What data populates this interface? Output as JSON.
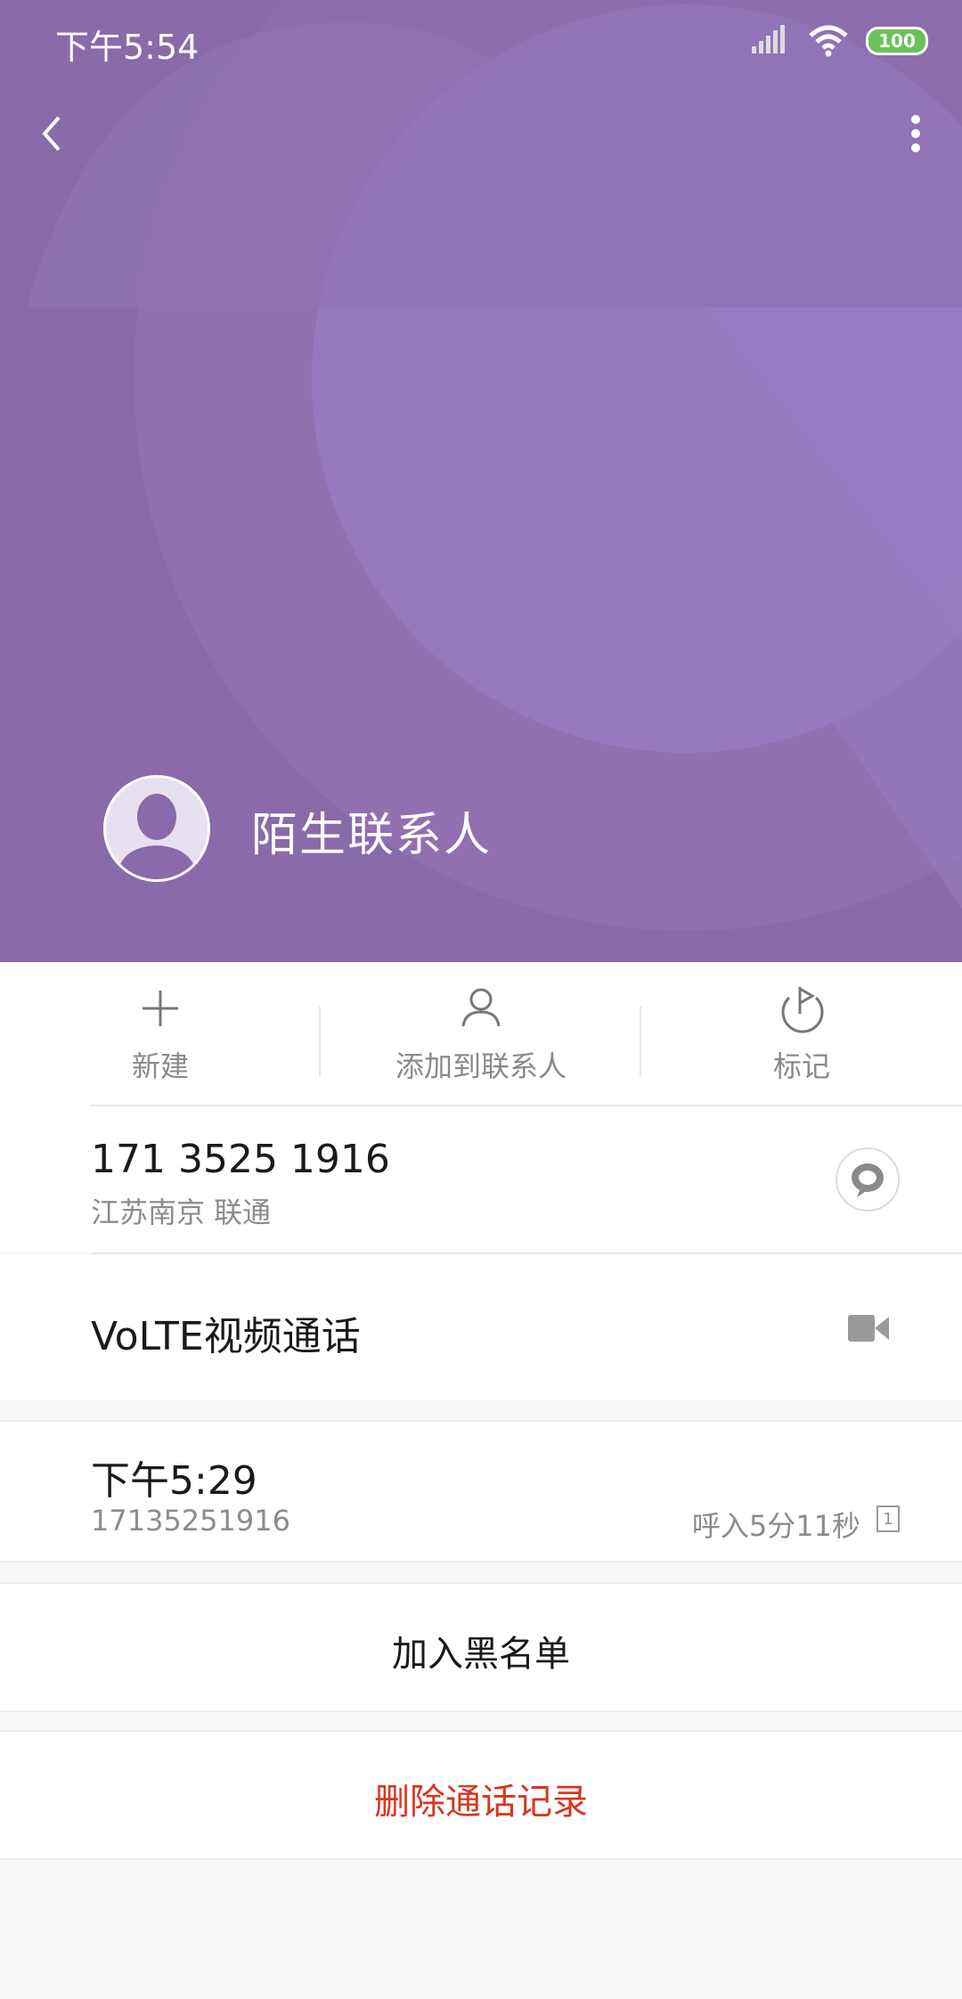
{
  "status_bar": {
    "time": "下午5:54",
    "battery": "100",
    "icons": [
      "signal-icon",
      "wifi-icon",
      "battery-icon"
    ]
  },
  "header": {
    "back_icon": "back-arrow-icon",
    "more_icon": "more-vertical-icon",
    "contact_name": "陌生联系人",
    "avatar_icon": "person-silhouette-icon"
  },
  "actions": [
    {
      "label": "新建",
      "icon": "plus-icon"
    },
    {
      "label": "添加到联系人",
      "icon": "person-add-icon"
    },
    {
      "label": "标记",
      "icon": "flag-icon"
    }
  ],
  "phone": {
    "number": "171 3525 1916",
    "location": "江苏南京 联通",
    "message_icon": "message-icon"
  },
  "volte": {
    "label": "VoLTE视频通话",
    "icon": "video-camera-icon"
  },
  "call_log": {
    "time": "下午5:29",
    "number": "17135251916",
    "duration": "呼入5分11秒",
    "sim_badge": "1"
  },
  "blacklist_label": "加入黑名单",
  "delete_label": "删除通话记录",
  "colors": {
    "hero_purple": "#8a6aaa",
    "delete_red": "#d9351f",
    "battery_green": "#6ac259"
  }
}
